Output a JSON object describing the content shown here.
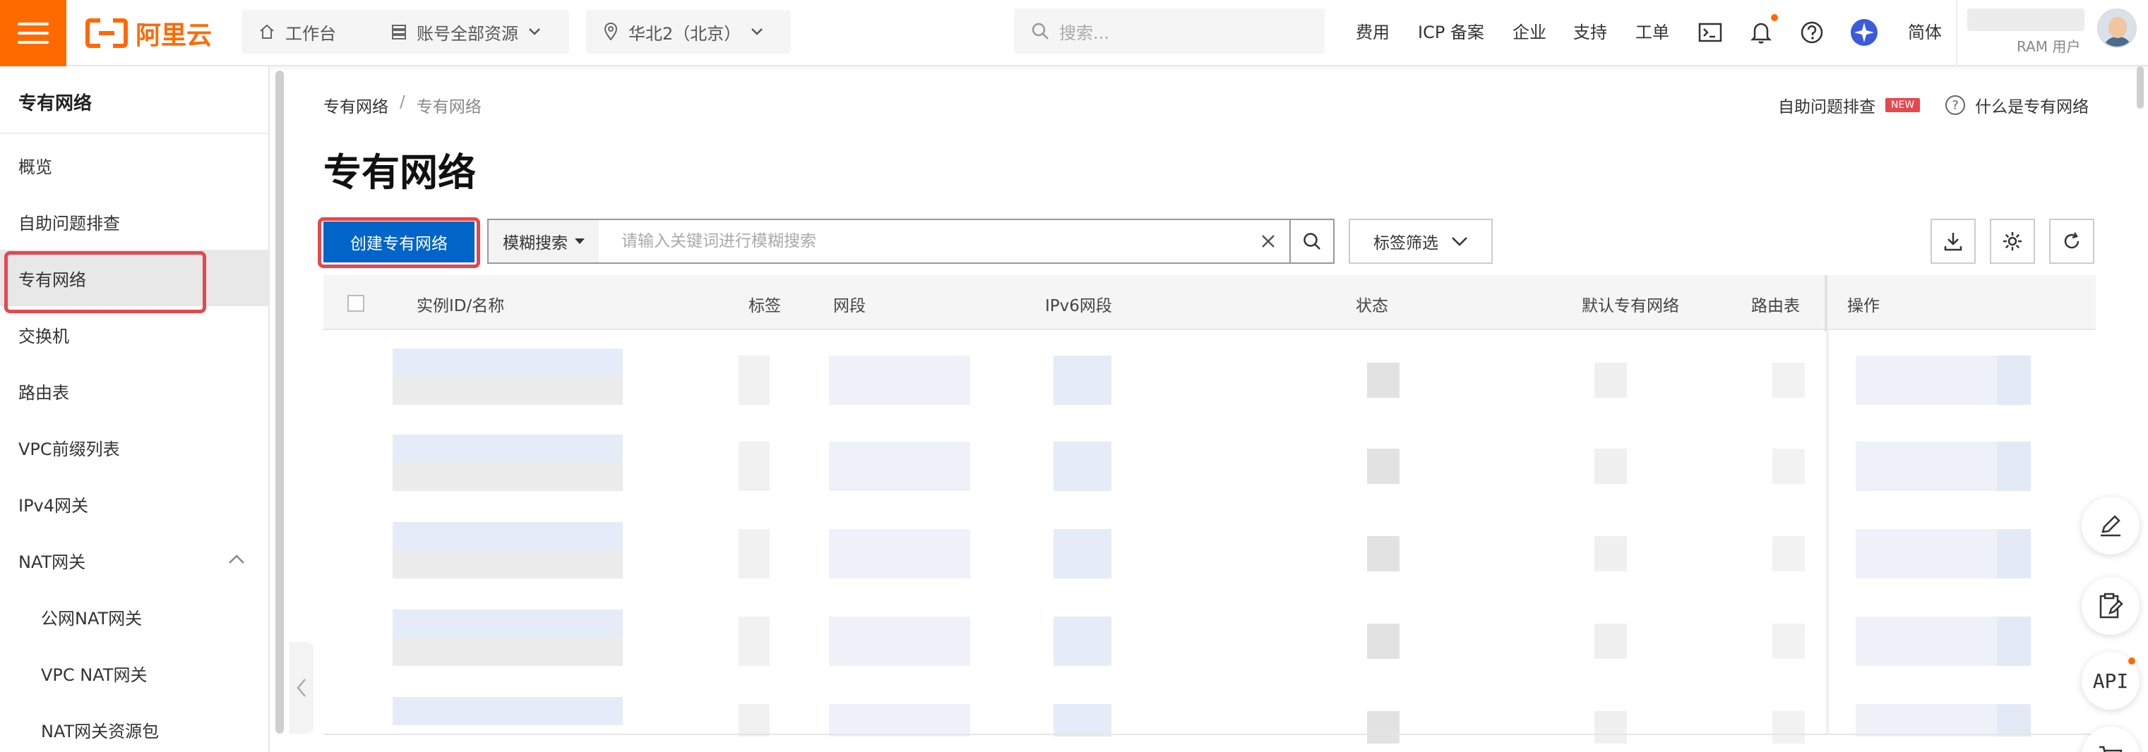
{
  "topbar": {
    "logo_text": "阿里云",
    "workbench": "工作台",
    "resources": "账号全部资源",
    "region": "华北2（北京）",
    "search_placeholder": "搜索...",
    "nav": [
      "费用",
      "ICP 备案",
      "企业",
      "支持",
      "工单"
    ],
    "language": "简体",
    "user_role": "RAM 用户"
  },
  "sidebar": {
    "title": "专有网络",
    "items": [
      {
        "label": "概览"
      },
      {
        "label": "自助问题排查"
      },
      {
        "label": "专有网络"
      },
      {
        "label": "交换机"
      },
      {
        "label": "路由表"
      },
      {
        "label": "VPC前缀列表"
      },
      {
        "label": "IPv4网关"
      },
      {
        "label": "NAT网关"
      },
      {
        "label": "公网NAT网关"
      },
      {
        "label": "VPC NAT网关"
      },
      {
        "label": "NAT网关资源包"
      }
    ]
  },
  "main": {
    "breadcrumb": [
      "专有网络",
      "专有网络"
    ],
    "breadcrumb_sep": "/",
    "help_troubleshoot": "自助问题排查",
    "badge_new": "NEW",
    "help_what": "什么是专有网络",
    "page_title": "专有网络",
    "create_button": "创建专有网络",
    "search_mode": "模糊搜索",
    "search_placeholder": "请输入关键词进行模糊搜索",
    "tag_filter": "标签筛选"
  },
  "table": {
    "columns": [
      "实例ID/名称",
      "标签",
      "网段",
      "IPv6网段",
      "状态",
      "默认专有网络",
      "路由表",
      "操作"
    ]
  },
  "float_tools": {
    "api": "API"
  },
  "colors": {
    "brand": "#ff6a00",
    "primary_button": "#0064c8",
    "highlight": "#e5484d",
    "blurred_link": "#e6ecf7"
  }
}
